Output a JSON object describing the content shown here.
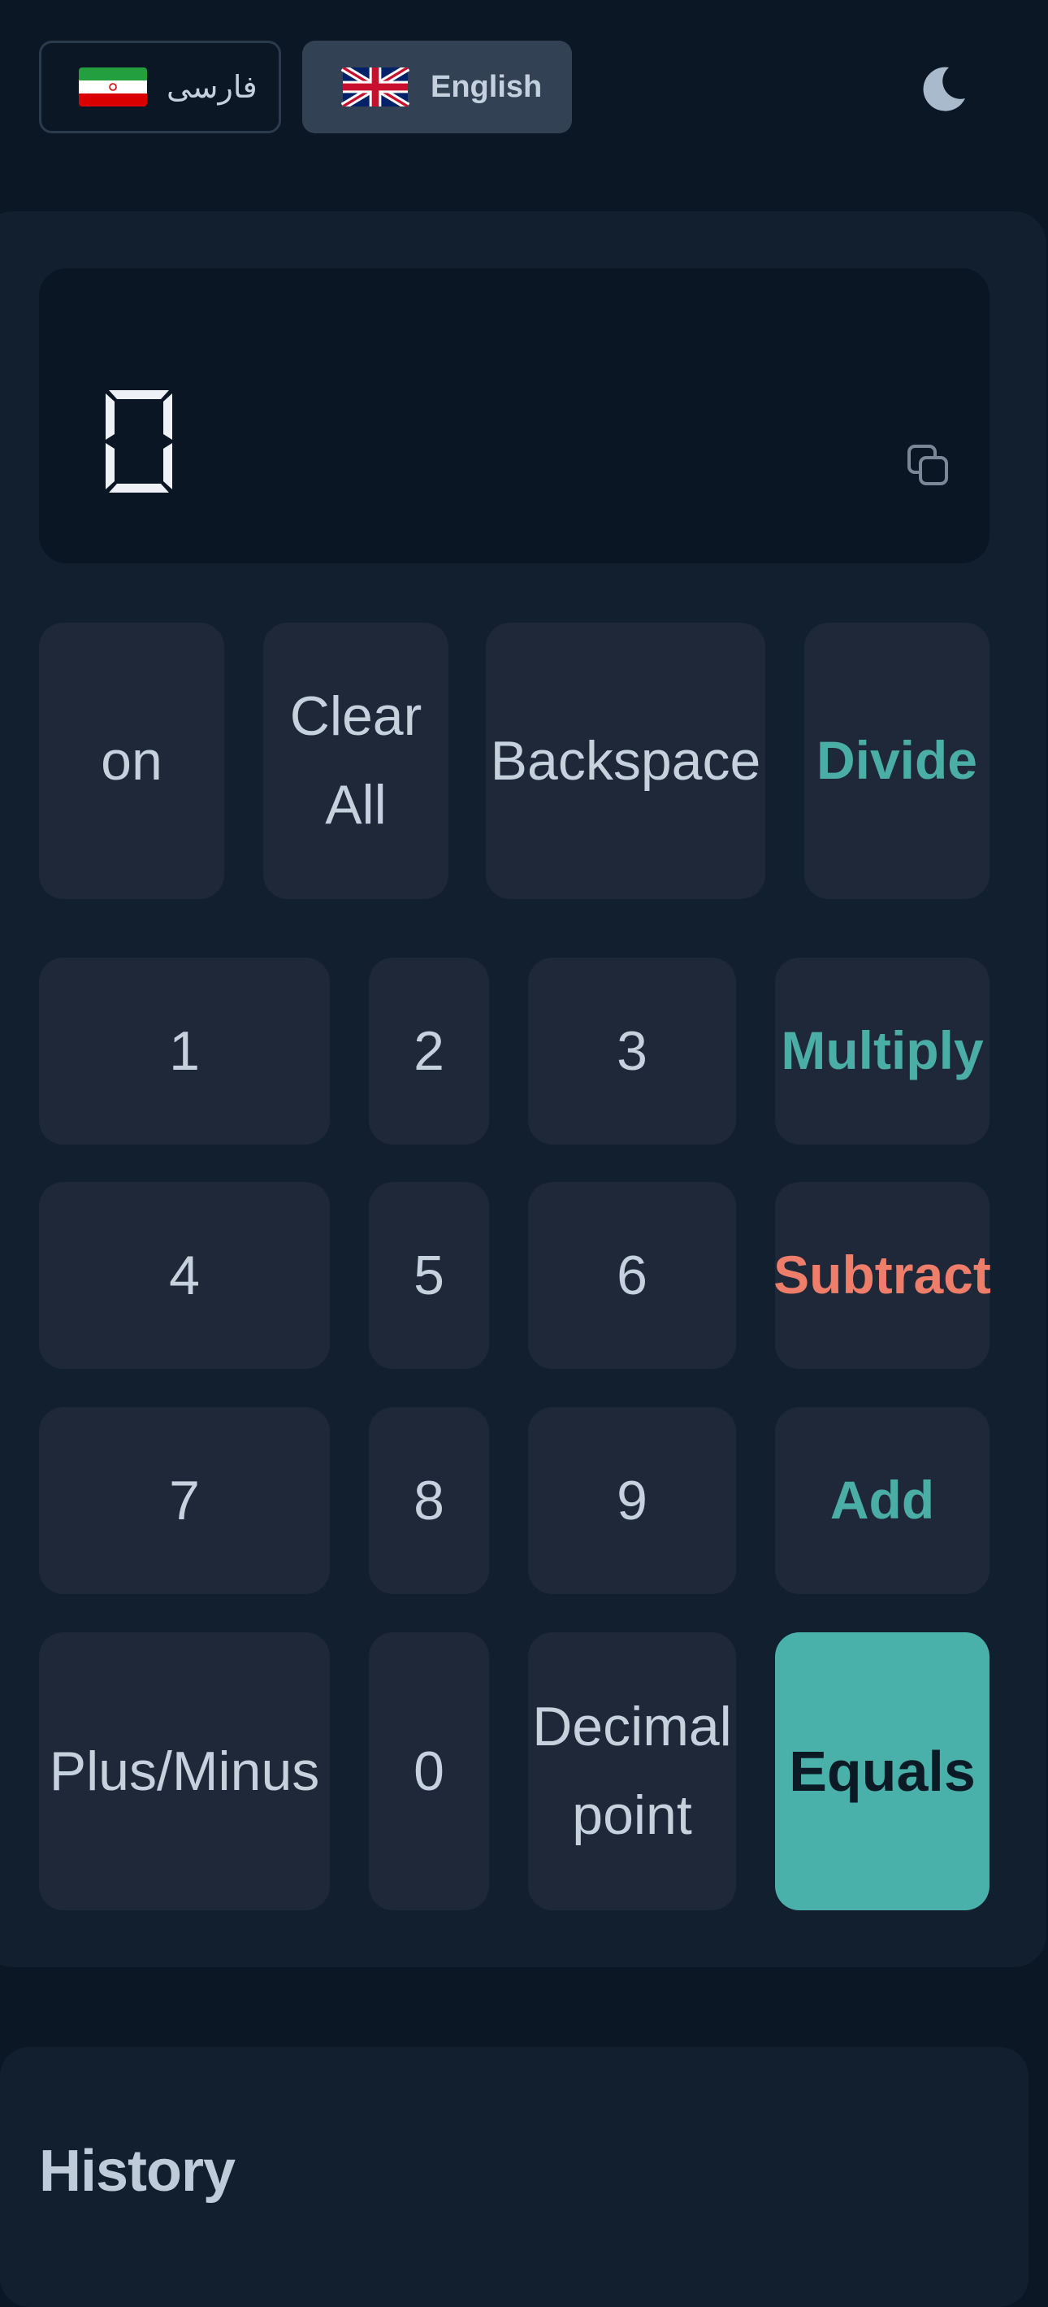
{
  "header": {
    "languages": [
      {
        "label": "فارسی",
        "flag": "iran-flag-icon",
        "selected": false
      },
      {
        "label": "English",
        "flag": "uk-flag-icon",
        "selected": true
      }
    ],
    "theme_icon": "moon-icon"
  },
  "display": {
    "value": "0",
    "copy_icon": "copy-icon"
  },
  "keypad": {
    "rows": [
      [
        "on",
        "Clear\nAll",
        "Backspace",
        "Divide"
      ],
      [
        "1",
        "2",
        "3",
        "Multiply"
      ],
      [
        "4",
        "5",
        "6",
        "Subtract"
      ],
      [
        "7",
        "8",
        "9",
        "Add"
      ],
      [
        "Plus/Minus",
        "0",
        "Decimal\npoint",
        "Equals"
      ]
    ]
  },
  "history": {
    "title": "History"
  },
  "colors": {
    "background": "#0b1725",
    "card": "#111f2e",
    "key": "#1e2838",
    "operator_accent": "#4aada6",
    "subtract_accent": "#ee7e6a",
    "equals_bg": "#4ab1aa"
  }
}
